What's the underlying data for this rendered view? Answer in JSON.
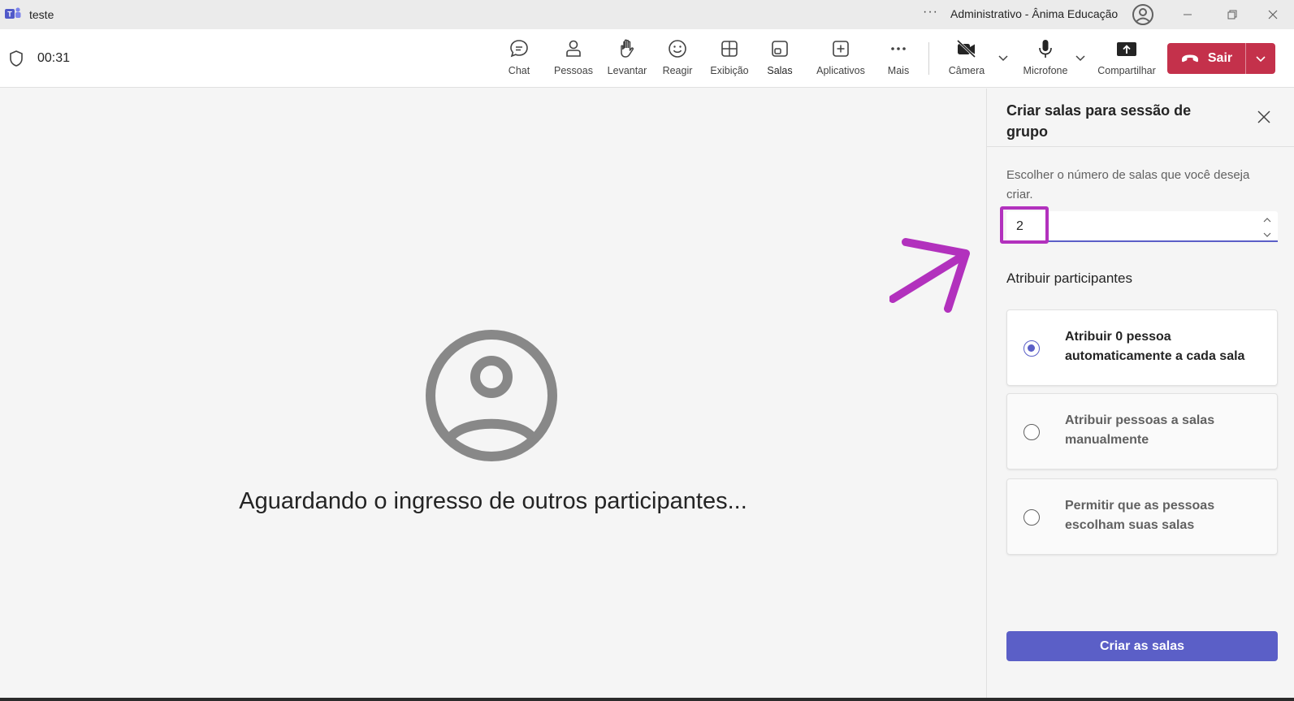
{
  "window": {
    "title": "teste",
    "org_name": "Administrativo - Ânima Educação"
  },
  "meeting": {
    "timer": "00:31"
  },
  "toolbar": {
    "items": [
      {
        "label": "Chat",
        "icon": "chat-icon"
      },
      {
        "label": "Pessoas",
        "icon": "people-icon"
      },
      {
        "label": "Levantar",
        "icon": "raise-hand-icon"
      },
      {
        "label": "Reagir",
        "icon": "react-icon"
      },
      {
        "label": "Exibição",
        "icon": "view-icon"
      },
      {
        "label": "Salas",
        "icon": "rooms-icon",
        "active": true
      },
      {
        "label": "Aplicativos",
        "icon": "apps-icon"
      },
      {
        "label": "Mais",
        "icon": "more-icon"
      },
      {
        "label": "Câmera",
        "icon": "camera-off-icon"
      },
      {
        "label": "Microfone",
        "icon": "microphone-icon"
      },
      {
        "label": "Compartilhar",
        "icon": "share-icon"
      }
    ],
    "leave_label": "Sair"
  },
  "stage": {
    "waiting_text": "Aguardando o ingresso de outros participantes..."
  },
  "panel": {
    "title": "Criar salas para sessão de grupo",
    "choose_label": "Escolher o número de salas que você deseja criar.",
    "room_count": "2",
    "assign_title": "Atribuir participantes",
    "options": [
      {
        "label": "Atribuir 0 pessoa automaticamente a cada sala",
        "selected": true
      },
      {
        "label": "Atribuir pessoas a salas manualmente",
        "selected": false
      },
      {
        "label": "Permitir que as pessoas escolham suas salas",
        "selected": false
      }
    ],
    "create_label": "Criar as salas"
  },
  "colors": {
    "accent": "#5b5fc7",
    "leave": "#c4314b",
    "annotation": "#b231bd"
  }
}
